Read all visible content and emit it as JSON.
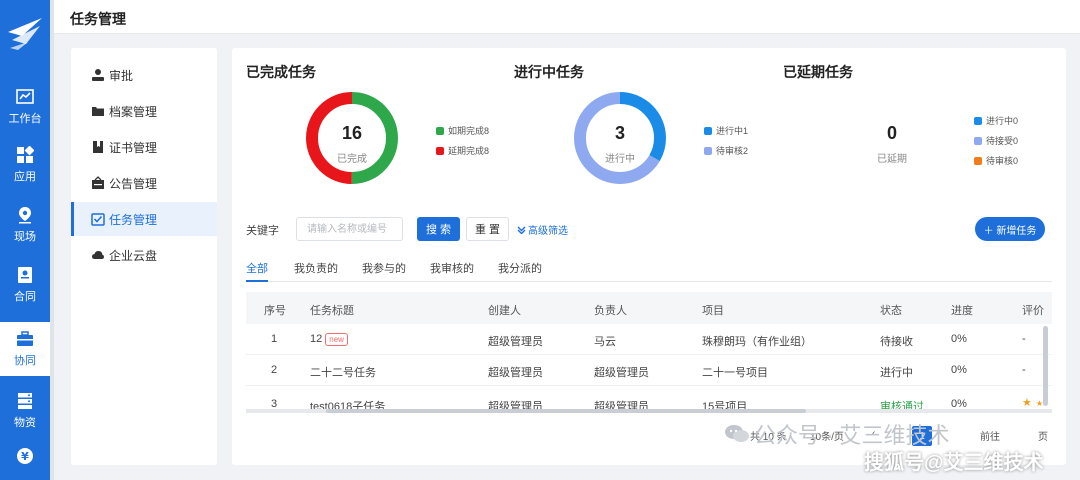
{
  "nav": {
    "items": [
      {
        "label": "工作台",
        "icon": "chart-icon"
      },
      {
        "label": "应用",
        "icon": "apps-icon"
      },
      {
        "label": "现场",
        "icon": "location-icon"
      },
      {
        "label": "合同",
        "icon": "contract-icon"
      },
      {
        "label": "协同",
        "icon": "briefcase-icon",
        "active": true
      },
      {
        "label": "物资",
        "icon": "storage-icon"
      },
      {
        "label": "",
        "icon": "yen-icon"
      }
    ]
  },
  "header": {
    "title": "任务管理"
  },
  "submenu": {
    "items": [
      {
        "label": "审批",
        "icon": "user-icon"
      },
      {
        "label": "档案管理",
        "icon": "folder-icon"
      },
      {
        "label": "证书管理",
        "icon": "bookmark-icon"
      },
      {
        "label": "公告管理",
        "icon": "announcement-icon"
      },
      {
        "label": "任务管理",
        "icon": "task-icon",
        "active": true
      },
      {
        "label": "企业云盘",
        "icon": "cloud-icon"
      }
    ]
  },
  "stats": {
    "completed": {
      "title": "已完成任务",
      "count": "16",
      "sub": "已完成",
      "legend": [
        {
          "label": "如期完成8",
          "color": "#2ea84a",
          "value": 8
        },
        {
          "label": "延期完成8",
          "color": "#e8161b",
          "value": 8
        }
      ]
    },
    "in_progress": {
      "title": "进行中任务",
      "count": "3",
      "sub": "进行中",
      "legend": [
        {
          "label": "进行中1",
          "color": "#1a8ce8",
          "value": 1
        },
        {
          "label": "待审核2",
          "color": "#8fa9f0",
          "value": 2
        }
      ]
    },
    "delayed": {
      "title": "已延期任务",
      "count": "0",
      "sub": "已延期",
      "legend": [
        {
          "label": "进行中0",
          "color": "#1a8ce8",
          "value": 0
        },
        {
          "label": "待接受0",
          "color": "#8fa9f0",
          "value": 0
        },
        {
          "label": "待审核0",
          "color": "#f07d1a",
          "value": 0
        }
      ]
    }
  },
  "search": {
    "label": "关键字",
    "placeholder": "请输入名称或编号",
    "search_button": "搜 索",
    "reset_button": "重 置",
    "advanced": "高级筛选",
    "new_button": "新增任务"
  },
  "tabs": [
    {
      "label": "全部",
      "active": true
    },
    {
      "label": "我负责的"
    },
    {
      "label": "我参与的"
    },
    {
      "label": "我审核的"
    },
    {
      "label": "我分派的"
    }
  ],
  "table": {
    "columns": [
      "序号",
      "任务标题",
      "创建人",
      "负责人",
      "项目",
      "状态",
      "进度",
      "评价"
    ],
    "rows": [
      {
        "no": "1",
        "title": "12",
        "badge": "new",
        "creator": "超级管理员",
        "owner": "马云",
        "project": "珠穆朗玛（有作业组）",
        "status": "待接收",
        "progress": "0%",
        "rating": "-",
        "status_color": "#555555"
      },
      {
        "no": "2",
        "title": "二十二号任务",
        "badge": "",
        "creator": "超级管理员",
        "owner": "超级管理员",
        "project": "二十一号项目",
        "status": "进行中",
        "progress": "0%",
        "rating": "-",
        "status_color": "#555555"
      },
      {
        "no": "3",
        "title": "test0618子任务",
        "badge": "",
        "creator": "超级管理员",
        "owner": "超级管理员",
        "project": "15号项目",
        "status": "审核通过",
        "progress": "0%",
        "rating": "",
        "status_color": "#2ea84a"
      }
    ]
  },
  "pager": {
    "total": "共 10 条",
    "page_size": "10条/页",
    "current_page": "1",
    "goto": "前往",
    "page_suffix": "页"
  },
  "watermarks": {
    "wechat": "公众号 · 艾三维技术",
    "sohu": "搜狐号@艾三维技术"
  },
  "colors": {
    "primary": "#1e6fd9",
    "success": "#2ea84a",
    "danger": "#e8161b"
  }
}
